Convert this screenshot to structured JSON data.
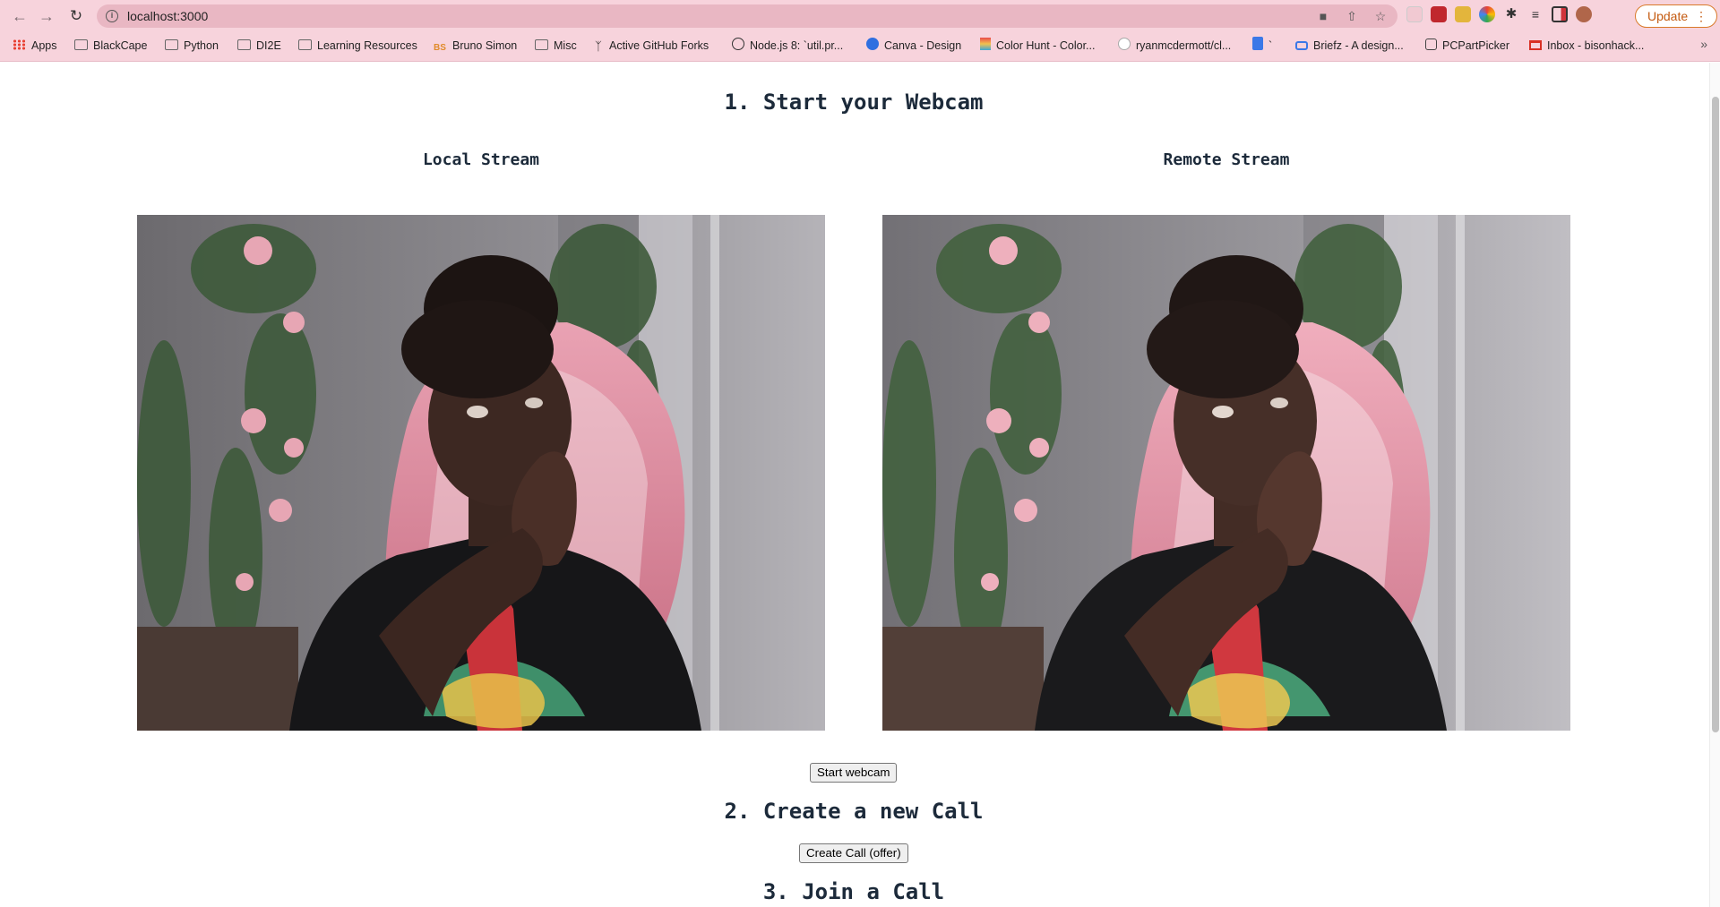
{
  "browser": {
    "url": "localhost:3000",
    "update_label": "Update",
    "bookmarks": [
      {
        "label": "Apps",
        "icon": "apps-grid-icon"
      },
      {
        "label": "BlackCape",
        "icon": "folder-icon"
      },
      {
        "label": "Python",
        "icon": "folder-icon"
      },
      {
        "label": "DI2E",
        "icon": "folder-icon"
      },
      {
        "label": "Learning Resources",
        "icon": "folder-icon"
      },
      {
        "label": "Bruno Simon",
        "icon": "bs-logo-icon"
      },
      {
        "label": "Misc",
        "icon": "folder-icon"
      },
      {
        "label": "Active GitHub Forks",
        "icon": "fork-icon"
      },
      {
        "label": "Node.js 8: `util.pr...",
        "icon": "site-icon"
      },
      {
        "label": "Canva - Design",
        "icon": "canva-icon"
      },
      {
        "label": "Color Hunt - Color...",
        "icon": "colorhunt-icon"
      },
      {
        "label": "ryanmcdermott/cl...",
        "icon": "github-icon"
      },
      {
        "label": "`",
        "icon": "docs-icon"
      },
      {
        "label": "Briefz - A design...",
        "icon": "briefz-icon"
      },
      {
        "label": "PCPartPicker",
        "icon": "pcpartpicker-icon"
      },
      {
        "label": "Inbox - bisonhack...",
        "icon": "gmail-icon"
      }
    ]
  },
  "page": {
    "step1_title": "1. Start your Webcam",
    "local_label": "Local Stream",
    "remote_label": "Remote Stream",
    "start_webcam_button": "Start webcam",
    "step2_title": "2. Create a new Call",
    "create_call_button": "Create Call (offer)",
    "step3_title": "3. Join a Call"
  }
}
